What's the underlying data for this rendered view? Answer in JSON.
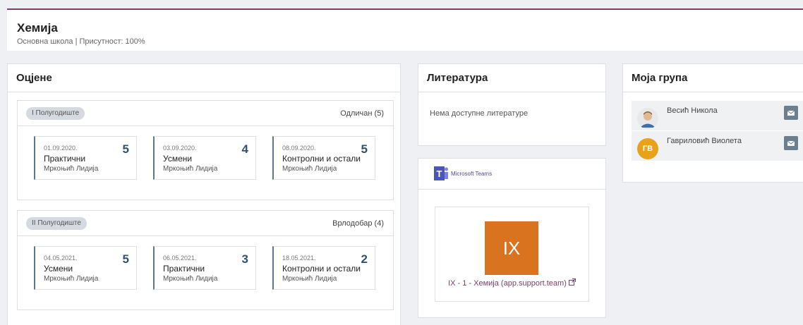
{
  "header": {
    "title": "Хемија",
    "subtitle": "Основна школа | Присутност: 100%"
  },
  "grades": {
    "title": "Оцјене",
    "semesters": [
      {
        "label": "I Полугодиште",
        "final_grade": "Одличан (5)",
        "items": [
          {
            "date": "01.09.2020.",
            "type": "Практични",
            "teacher": "Мркоњић Лидија",
            "value": "5"
          },
          {
            "date": "03.09.2020.",
            "type": "Усмени",
            "teacher": "Мркоњић Лидија",
            "value": "4"
          },
          {
            "date": "08.09.2020.",
            "type": "Контролни и остали",
            "teacher": "Мркоњић Лидија",
            "value": "5"
          }
        ]
      },
      {
        "label": "II Полугодиште",
        "final_grade": "Врлодобар (4)",
        "items": [
          {
            "date": "04.05.2021.",
            "type": "Усмени",
            "teacher": "Мркоњић Лидија",
            "value": "5"
          },
          {
            "date": "06.05.2021.",
            "type": "Практични",
            "teacher": "Мркоњић Лидија",
            "value": "3"
          },
          {
            "date": "18.05.2021.",
            "type": "Контролни и остали",
            "teacher": "Мркоњић Лидија",
            "value": "2"
          }
        ]
      }
    ]
  },
  "literature": {
    "title": "Литература",
    "empty_text": "Нема доступне литературе"
  },
  "teams": {
    "brand": "Microsoft Teams",
    "tile": "IX",
    "link": "IX - 1 - Хемија (app.support.team)",
    "icons": {
      "logo": "teams-logo-icon",
      "external": "external-link-icon"
    }
  },
  "group": {
    "title": "Моја група",
    "members": [
      {
        "name": "Весић Никола",
        "initials": "",
        "avatar_icon": "user-photo-icon",
        "mail_icon": "envelope-icon"
      },
      {
        "name": "Гавриловић Виолета",
        "initials": "ГВ",
        "avatar_color": "#e8a21a",
        "mail_icon": "envelope-icon"
      }
    ]
  },
  "colors": {
    "accent": "#7a3f6a",
    "grade": "#2e5273",
    "teams_tile": "#d9731f"
  }
}
